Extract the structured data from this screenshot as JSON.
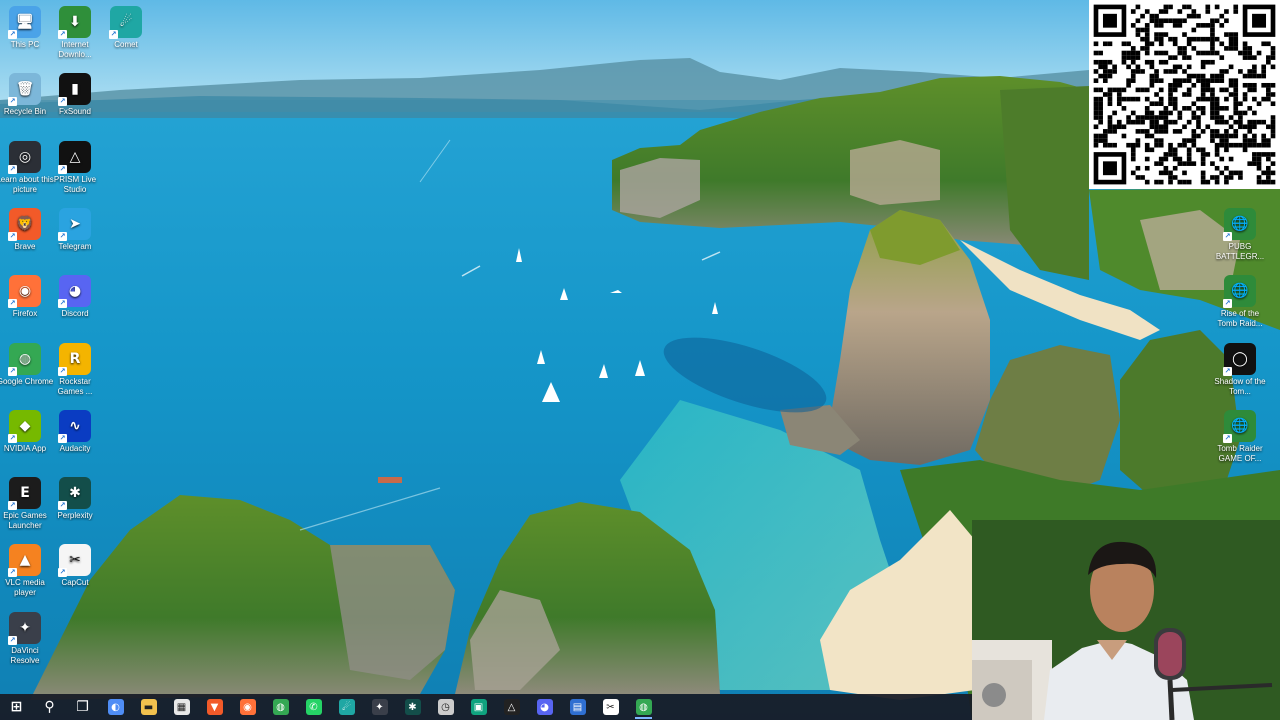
{
  "desktop": {
    "icons_left": [
      {
        "label": "This PC",
        "icon": "this-pc-icon",
        "color": "#4aa3e8",
        "glyph": "🖥"
      },
      {
        "label": "Recycle Bin",
        "icon": "recycle-bin-icon",
        "color": "#7cb7d9",
        "glyph": "🗑"
      },
      {
        "label": "Learn about this picture",
        "icon": "learn-about-picture-icon",
        "color": "#2b2f36",
        "glyph": "◎"
      },
      {
        "label": "Brave",
        "icon": "brave-icon",
        "color": "#f25a29",
        "glyph": "🦁"
      },
      {
        "label": "Firefox",
        "icon": "firefox-icon",
        "color": "#ff7139",
        "glyph": "◉"
      },
      {
        "label": "Google Chrome",
        "icon": "chrome-icon",
        "color": "#34a853",
        "glyph": "◍"
      },
      {
        "label": "NVIDIA App",
        "icon": "nvidia-icon",
        "color": "#76b900",
        "glyph": "◆"
      },
      {
        "label": "Epic Games Launcher",
        "icon": "epic-games-icon",
        "color": "#1c1c1c",
        "glyph": "E"
      },
      {
        "label": "VLC media player",
        "icon": "vlc-icon",
        "color": "#f58220",
        "glyph": "▲"
      },
      {
        "label": "DaVinci Resolve",
        "icon": "davinci-resolve-icon",
        "color": "#3a3f4a",
        "glyph": "✦"
      }
    ],
    "icons_col2": [
      {
        "label": "Internet Downlo...",
        "icon": "internet-download-manager-icon",
        "color": "#2f8f3a",
        "glyph": "⬇"
      },
      {
        "label": "FxSound",
        "icon": "fxsound-icon",
        "color": "#111111",
        "glyph": "▮"
      },
      {
        "label": "PRISM Live Studio",
        "icon": "prism-live-studio-icon",
        "color": "#111111",
        "glyph": "△"
      },
      {
        "label": "Telegram",
        "icon": "telegram-icon",
        "color": "#2aa3e0",
        "glyph": "➤"
      },
      {
        "label": "Discord",
        "icon": "discord-icon",
        "color": "#5865f2",
        "glyph": "◕"
      },
      {
        "label": "Rockstar Games ...",
        "icon": "rockstar-games-icon",
        "color": "#f4b400",
        "glyph": "R"
      },
      {
        "label": "Audacity",
        "icon": "audacity-icon",
        "color": "#0a3cc2",
        "glyph": "∿"
      },
      {
        "label": "Perplexity",
        "icon": "perplexity-icon",
        "color": "#134e4a",
        "glyph": "✱"
      },
      {
        "label": "CapCut",
        "icon": "capcut-icon",
        "color": "#f5f5f5",
        "glyph": "✂"
      }
    ],
    "icons_col3": [
      {
        "label": "Comet",
        "icon": "comet-icon",
        "color": "#1fa7a4",
        "glyph": "☄"
      }
    ],
    "icons_right": [
      {
        "label": "PUBG BATTLEGR...",
        "icon": "pubg-icon",
        "color": "#2e8b3a",
        "glyph": "🌐"
      },
      {
        "label": "Rise of the Tomb Raid...",
        "icon": "rise-of-tomb-raider-icon",
        "color": "#2e8b3a",
        "glyph": "🌐"
      },
      {
        "label": "Shadow of the Tom...",
        "icon": "shadow-of-tomb-raider-icon",
        "color": "#111111",
        "glyph": "◯"
      },
      {
        "label": "Tomb Raider GAME OF...",
        "icon": "tomb-raider-icon",
        "color": "#2e8b3a",
        "glyph": "🌐"
      }
    ]
  },
  "taskbar": {
    "items": [
      {
        "name": "start-button",
        "icon": "windows-icon",
        "color": "#ffffff",
        "glyph": "⊞"
      },
      {
        "name": "search-button",
        "icon": "search-icon",
        "color": "#ffffff",
        "glyph": "⚲"
      },
      {
        "name": "task-view-button",
        "icon": "task-view-icon",
        "color": "#ffffff",
        "glyph": "❐"
      },
      {
        "name": "taskbar-copilot",
        "icon": "copilot-icon",
        "color": "#4f8df5",
        "glyph": "◐"
      },
      {
        "name": "taskbar-file-explorer",
        "icon": "folder-icon",
        "color": "#f2c14e",
        "glyph": "▬"
      },
      {
        "name": "taskbar-store",
        "icon": "store-icon",
        "color": "#e8e8e8",
        "glyph": "▦"
      },
      {
        "name": "taskbar-brave",
        "icon": "brave-icon",
        "color": "#f25a29",
        "glyph": "▼"
      },
      {
        "name": "taskbar-firefox",
        "icon": "firefox-icon",
        "color": "#ff7139",
        "glyph": "◉"
      },
      {
        "name": "taskbar-chrome",
        "icon": "chrome-icon",
        "color": "#34a853",
        "glyph": "◍"
      },
      {
        "name": "taskbar-whatsapp",
        "icon": "whatsapp-icon",
        "color": "#25d366",
        "glyph": "✆"
      },
      {
        "name": "taskbar-comet",
        "icon": "comet-icon",
        "color": "#1fa7a4",
        "glyph": "☄"
      },
      {
        "name": "taskbar-davinci",
        "icon": "davinci-resolve-icon",
        "color": "#3a3f4a",
        "glyph": "✦"
      },
      {
        "name": "taskbar-perplexity",
        "icon": "perplexity-icon",
        "color": "#134e4a",
        "glyph": "✱"
      },
      {
        "name": "taskbar-clock-app",
        "icon": "clock-icon",
        "color": "#cccccc",
        "glyph": "◷"
      },
      {
        "name": "taskbar-app-green",
        "icon": "app-icon",
        "color": "#10a37f",
        "glyph": "▣"
      },
      {
        "name": "taskbar-prism",
        "icon": "prism-live-studio-icon",
        "color": "#222222",
        "glyph": "△"
      },
      {
        "name": "taskbar-discord",
        "icon": "discord-icon",
        "color": "#5865f2",
        "glyph": "◕"
      },
      {
        "name": "taskbar-app-blue",
        "icon": "app-icon",
        "color": "#2f6fd1",
        "glyph": "▤"
      },
      {
        "name": "taskbar-capcut",
        "icon": "capcut-icon",
        "color": "#ffffff",
        "glyph": "✂"
      },
      {
        "name": "taskbar-chrome-active",
        "icon": "chrome-icon",
        "color": "#34a853",
        "glyph": "◍",
        "active": true
      }
    ]
  }
}
